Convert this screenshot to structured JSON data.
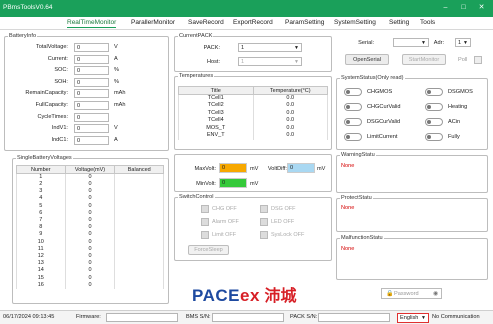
{
  "window": {
    "title": "PBmsToolsV0.64",
    "min_icon": "minimize-icon",
    "max_icon": "maximize-icon",
    "close_icon": "close-icon"
  },
  "menu": [
    "RealTimeMonitor",
    "ParallerMonitor",
    "SaveRecord",
    "ExportRecord",
    "ParamSetting",
    "SystemSetting",
    "Setting",
    "Tools"
  ],
  "battery_info": {
    "title": "BatteryInfo",
    "rows": [
      {
        "label": "TotalVoltage:",
        "value": "0",
        "unit": "V"
      },
      {
        "label": "Current:",
        "value": "0",
        "unit": "A"
      },
      {
        "label": "SOC:",
        "value": "0",
        "unit": "%"
      },
      {
        "label": "SOH:",
        "value": "0",
        "unit": "%"
      },
      {
        "label": "RemainCapacity:",
        "value": "0",
        "unit": "mAh"
      },
      {
        "label": "FullCapacity:",
        "value": "0",
        "unit": "mAh"
      },
      {
        "label": "CycleTimes:",
        "value": "0",
        "unit": ""
      },
      {
        "label": "IndV1:",
        "value": "0",
        "unit": "V"
      },
      {
        "label": "IndC1:",
        "value": "0",
        "unit": "A"
      }
    ]
  },
  "current_pack": {
    "title": "CurrentPACK",
    "pack_label": "PACK:",
    "pack_value": "1",
    "host_label": "Host:",
    "host_value": "1"
  },
  "temperatures": {
    "title": "Temperatures",
    "headers": [
      "Title",
      "Temperature(°C)"
    ],
    "rows": [
      [
        "TCell1",
        "0.0"
      ],
      [
        "TCell2",
        "0.0"
      ],
      [
        "TCell3",
        "0.0"
      ],
      [
        "TCell4",
        "0.0"
      ],
      [
        "MOS_T",
        "0.0"
      ],
      [
        "ENV_T",
        "0.0"
      ]
    ]
  },
  "serial": {
    "serial_label": "Serial:",
    "serial_value": "",
    "adr_label": "Adr:",
    "adr_value": "1",
    "open_label": "OpenSerial",
    "start_label": "StartMonitor",
    "poll_label": "Poll"
  },
  "system_status": {
    "title": "SystemStatus(Only read)",
    "items": [
      "CHGMOS",
      "DSGMOS",
      "CHGCurValid",
      "Heating",
      "DSGCurValid",
      "ACin",
      "LimitCurrent",
      "Fully"
    ]
  },
  "single_voltages": {
    "title": "SingleBatteryVoltages",
    "headers": [
      "Number",
      "Voltage(mV)",
      "Balanced"
    ],
    "rows": [
      [
        "1",
        "0",
        ""
      ],
      [
        "2",
        "0",
        ""
      ],
      [
        "3",
        "0",
        ""
      ],
      [
        "4",
        "0",
        ""
      ],
      [
        "5",
        "0",
        ""
      ],
      [
        "6",
        "0",
        ""
      ],
      [
        "7",
        "0",
        ""
      ],
      [
        "8",
        "0",
        ""
      ],
      [
        "9",
        "0",
        ""
      ],
      [
        "10",
        "0",
        ""
      ],
      [
        "11",
        "0",
        ""
      ],
      [
        "12",
        "0",
        ""
      ],
      [
        "13",
        "0",
        ""
      ],
      [
        "14",
        "0",
        ""
      ],
      [
        "15",
        "0",
        ""
      ],
      [
        "16",
        "0",
        ""
      ]
    ]
  },
  "volt_stats": {
    "max_label": "MaxVolt:",
    "max_value": "0",
    "max_unit": "mV",
    "max_color": "#f7a800",
    "diff_label": "VoltDiff:",
    "diff_value": "0",
    "diff_unit": "mV",
    "diff_color": "#a9d8f2",
    "min_label": "MinVolt:",
    "min_value": "0",
    "min_unit": "mV",
    "min_color": "#35c93a"
  },
  "switch_control": {
    "title": "SwitchControl",
    "left": [
      "CHG OFF",
      "Alarm OFF",
      "Limit OFF"
    ],
    "right": [
      "DSG OFF",
      "LED OFF",
      "SysLock OFF"
    ],
    "button": "ForceSleep"
  },
  "warning": {
    "title": "WarningStatu",
    "text": "None"
  },
  "protect": {
    "title": "ProtectStatu",
    "text": "None"
  },
  "malfunction": {
    "title": "MalfunctionStatu",
    "text": "None"
  },
  "password": {
    "placeholder": "Password",
    "lock_icon": "lock-icon",
    "eye_icon": "eye-icon"
  },
  "logo": {
    "text": "PACEex",
    "chinese": "沛城",
    "red": "#d71f26",
    "blue": "#1e4aa0"
  },
  "status_bar": {
    "datetime": "06/17/2024 09:13:45",
    "firmware_label": "Firmware:",
    "bms_label": "BMS S/N:",
    "pack_label": "PACK S/N:",
    "language": "English",
    "comm": "No Communication"
  }
}
